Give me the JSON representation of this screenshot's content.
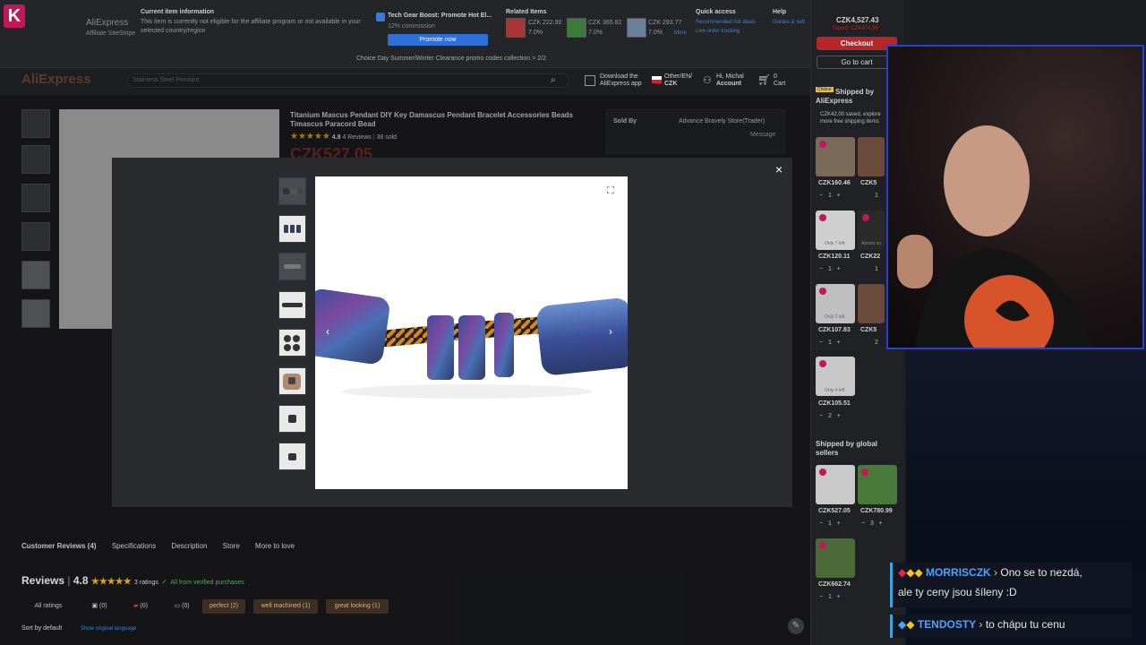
{
  "affiliate": {
    "logo": "AliExpress",
    "logo_sub": "Affiliate SiteStripe",
    "current_item_title": "Current item information",
    "current_item_text1": "This item is currently not eligible for the affiliate program or not available in your",
    "current_item_text2": "selected country/region",
    "promo_title": "Tech Gear Boost: Promote Hot El...",
    "promo_commission": "12% commission",
    "promote_button": "Promote now",
    "related_title": "Related Items",
    "related": [
      {
        "price": "CZK 222.90",
        "pct": "7.0%"
      },
      {
        "price": "CZK 365.82",
        "pct": "7.0%"
      },
      {
        "price": "CZK 293.77",
        "pct": "7.0%"
      }
    ],
    "more": "More",
    "quick_access_title": "Quick access",
    "quick_access_1": "Recommended hot deals",
    "quick_access_2": "Live order tracking",
    "help_title": "Help",
    "help_link": "Guides & sett",
    "banner": "Choice Day Summer/Winter Clearance promo codes collection  >  2/2"
  },
  "header": {
    "logo": "AliExpress",
    "search_placeholder": "Stainless Steel Pendant",
    "download_app_1": "Download the",
    "download_app_2": "AliExpress app",
    "locale_1": "Other/EN/",
    "locale_2": "CZK",
    "account_1": "Hi, Michal",
    "account_2": "Account",
    "cart_label": "Cart",
    "cart_count": "0"
  },
  "product": {
    "title": "Titanium Mascus Pendant DIY Key Damascus Pendant Bracelet Accessories Beads Timascus Paracord Bead",
    "rating": "4.8",
    "reviews": "4 Reviews",
    "sold": "38 sold",
    "price": "CZK527.05",
    "old_price": "CZK",
    "sold_by_label": "Sold By",
    "store": "Advance Bravely Store(Trader)",
    "message": "Message"
  },
  "modal": {
    "close": "×"
  },
  "reviews": {
    "tabs": [
      "Customer Reviews (4)",
      "Specifications",
      "Description",
      "Store",
      "More to love"
    ],
    "title": "Reviews",
    "score": "4.8",
    "ratings": "3 ratings",
    "verified": "All from verified purchases",
    "filter_all": "All ratings",
    "photo_count": "(0)",
    "flag_count": "(0)",
    "comment_count": "(0)",
    "chips": [
      "perfect (2)",
      "well machined (1)",
      "great looking (1)"
    ],
    "sort": "Sort by default",
    "show_original": "Show original language"
  },
  "cart": {
    "total": "CZK4,527.43",
    "saved": "Saved: CZK474.56",
    "checkout": "Checkout",
    "go_to_cart": "Go to cart",
    "choice_badge": "Choice",
    "shipped_by_ae_1": "Shipped by",
    "shipped_by_ae_2": "AliExpress",
    "saved_line": "CZK42.00 saved, explore more free shipping items",
    "items": [
      {
        "price": "CZK160.46",
        "qty": "1"
      },
      {
        "price": "CZK120.11",
        "qty": "1",
        "note": "Only 7 left"
      },
      {
        "price": "CZK107.83",
        "qty": "1",
        "note": "Only 3 left"
      },
      {
        "price": "CZK105.51",
        "qty": "2",
        "note": "Only 4 left"
      }
    ],
    "items_col2": [
      {
        "price": "CZK5",
        "qty": "1"
      },
      {
        "price": "CZK22",
        "qty": "1",
        "note": "Almost so"
      },
      {
        "price": "CZK5",
        "qty": "2"
      }
    ],
    "global_title_1": "Shipped by global",
    "global_title_2": "sellers",
    "global_items": [
      {
        "price": "CZK527.05",
        "qty": "1"
      },
      {
        "price": "CZK780.99",
        "qty": "3"
      },
      {
        "price": "CZK662.74",
        "qty": "1"
      }
    ]
  },
  "chat": [
    {
      "user": "MORRISCZK",
      "color": "#4aa3ff",
      "msg1": "Ono se to nezdá,",
      "msg2": "ale ty ceny jsou šíleny :D"
    },
    {
      "user": "TENDOSTY",
      "color": "#4aa3ff",
      "msg1": "to chápu tu cenu",
      "msg2": ""
    }
  ],
  "colors": {
    "accent": "#b3262a",
    "link": "#2f6fd8",
    "star": "#d7a21b"
  }
}
